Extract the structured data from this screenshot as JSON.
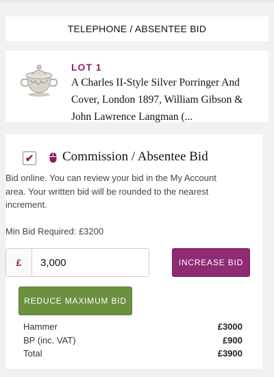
{
  "header": {
    "title": "TELEPHONE / ABSENTEE BID"
  },
  "lot": {
    "label": "LOT 1",
    "title": "A Charles II-Style Silver Porringer And Cover, London 1897, William Gibson & John Lawrence Langman (...",
    "image_icon": "silver-porringer-image"
  },
  "bid": {
    "checkbox_checked": true,
    "checkmark": "✔",
    "heading_icon": "mouse-icon",
    "heading": "Commission / Absentee Bid",
    "description": "Bid online. You can review your bid in the My Account area. Your written bid will be rounded to the nearest increment.",
    "min_bid": "Min Bid Required: £3200",
    "currency_symbol": "£",
    "amount_value": "3,000",
    "increase_label": "INCREASE BID",
    "reduce_label": "REDUCE MAXIMUM BID"
  },
  "totals": [
    {
      "label": "Hammer",
      "value": "£3000"
    },
    {
      "label": "BP (inc. VAT)",
      "value": "£900"
    },
    {
      "label": "Total",
      "value": "£3900"
    }
  ],
  "colors": {
    "accent": "#8e1f67",
    "increase_button": "#8e2b72",
    "reduce_button": "#6a9040",
    "background": "#f1f1f1"
  }
}
